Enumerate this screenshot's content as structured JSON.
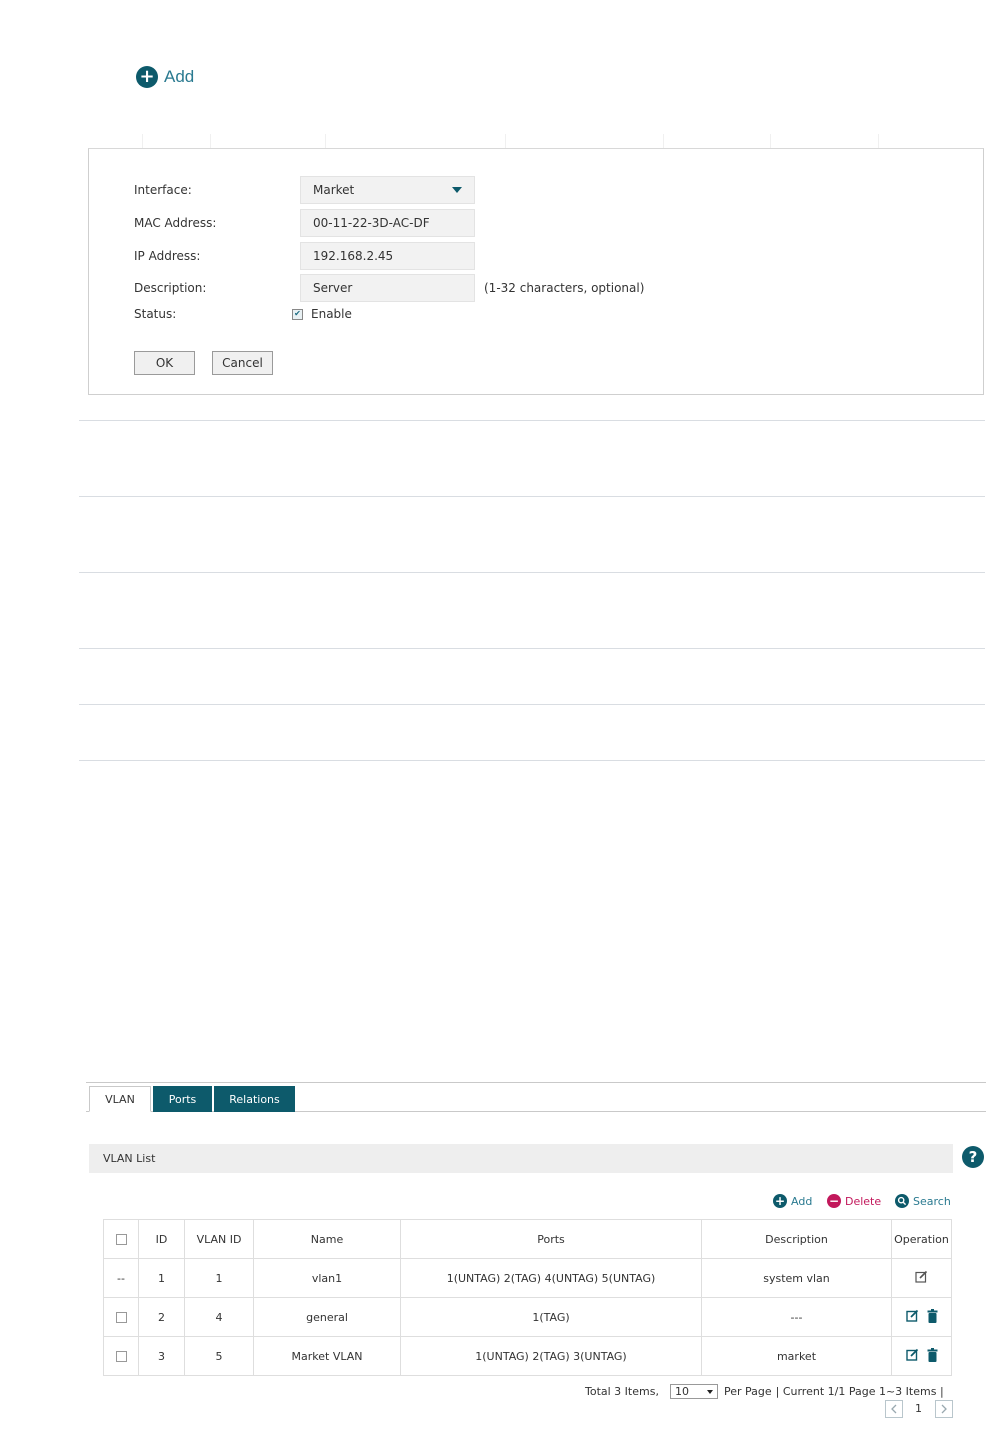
{
  "top": {
    "add_label": "Add"
  },
  "form": {
    "interface_label": "Interface:",
    "interface_value": "Market",
    "mac_label": "MAC Address:",
    "mac_value": "00-11-22-3D-AC-DF",
    "ip_label": "IP Address:",
    "ip_value": "192.168.2.45",
    "desc_label": "Description:",
    "desc_value": "Server",
    "desc_hint": "(1-32 characters, optional)",
    "status_label": "Status:",
    "enable_label": "Enable",
    "enable_checked": true,
    "ok_label": "OK",
    "cancel_label": "Cancel"
  },
  "tabs": [
    {
      "label": "VLAN",
      "active": true
    },
    {
      "label": "Ports",
      "active": false
    },
    {
      "label": "Relations",
      "active": false
    }
  ],
  "vlan_list": {
    "title": "VLAN List",
    "toolbar": {
      "add": "Add",
      "delete": "Delete",
      "search": "Search"
    },
    "columns": [
      "ID",
      "VLAN ID",
      "Name",
      "Ports",
      "Description",
      "Operation"
    ],
    "rows": [
      {
        "select": "--",
        "id": "1",
        "vlan_id": "1",
        "name": "vlan1",
        "ports": "1(UNTAG) 2(TAG) 4(UNTAG) 5(UNTAG)",
        "description": "system vlan"
      },
      {
        "select": "",
        "id": "2",
        "vlan_id": "4",
        "name": "general",
        "ports": "1(TAG)",
        "description": "---"
      },
      {
        "select": "",
        "id": "3",
        "vlan_id": "5",
        "name": "Market VLAN",
        "ports": "1(UNTAG) 2(TAG) 3(UNTAG)",
        "description": "market"
      }
    ]
  },
  "pager": {
    "total": "Total 3 Items,",
    "per_page_value": "10",
    "per_page_label": "Per Page",
    "current": "| Current 1/1 Page 1~3 Items |",
    "page_number": "1"
  },
  "colors": {
    "accent": "#0d5a6b",
    "delete": "#c2185b",
    "link": "#2a7a90"
  }
}
